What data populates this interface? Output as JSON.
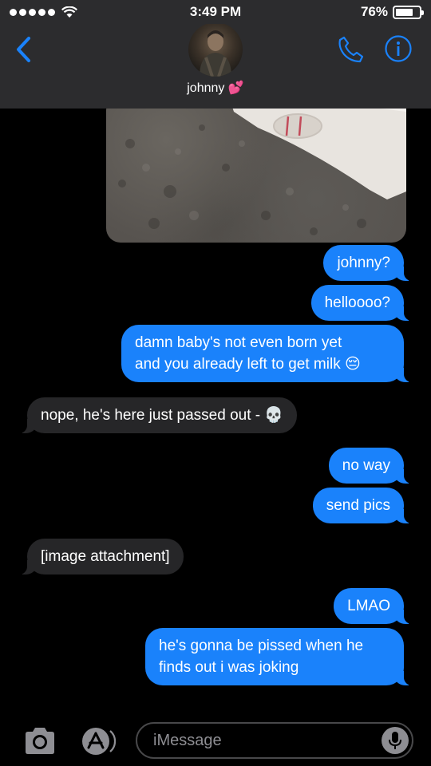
{
  "status": {
    "time": "3:49 PM",
    "battery": "76%",
    "battery_level": 0.76
  },
  "header": {
    "contact_name": "johnny",
    "name_emoji": "💕"
  },
  "messages": [
    {
      "from": "me",
      "kind": "image"
    },
    {
      "from": "me",
      "text": "johnny?"
    },
    {
      "from": "me",
      "text": "helloooo?"
    },
    {
      "from": "me",
      "line1": "damn baby's not even born yet",
      "line2": "and you already left to get milk",
      "emoji": "😔"
    },
    {
      "from": "them",
      "text": "nope, he's here just passed out -",
      "emoji": "💀"
    },
    {
      "from": "me",
      "text": "no way"
    },
    {
      "from": "me",
      "text": "send pics"
    },
    {
      "from": "them",
      "text": "[image attachment]"
    },
    {
      "from": "me",
      "text": "LMAO"
    },
    {
      "from": "me",
      "line1": "he's gonna be pissed when he",
      "line2": "finds out i was joking"
    }
  ],
  "input": {
    "placeholder": "iMessage"
  },
  "icons": {
    "back": "chevron-left-icon",
    "phone": "phone-icon",
    "info": "info-icon",
    "camera": "camera-icon",
    "appstore": "app-store-icon",
    "mic": "microphone-icon"
  },
  "colors": {
    "accent": "#1a82fb",
    "received_bubble": "#262628",
    "header_bg": "#2c2c2e"
  }
}
